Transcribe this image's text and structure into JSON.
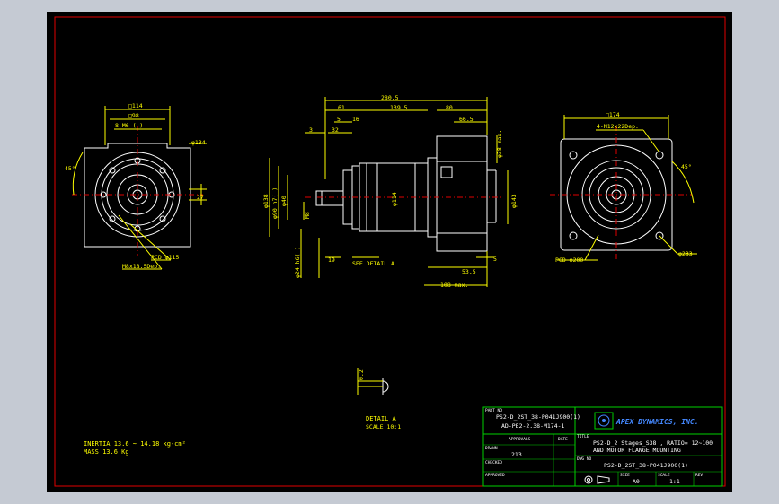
{
  "colors": {
    "background": "#c5cad3",
    "sheet": "#000000",
    "frame": "#e00000",
    "geometry": "#ffffff",
    "dimensions": "#ffff00",
    "title_block": "#00d000",
    "brand": "#4488ff"
  },
  "left_view": {
    "sq_top": "□114",
    "sq_inner": "□98",
    "bolt_pattern": "8 M6 ( )",
    "dia_134": "φ134",
    "angle": "45°",
    "dim_27": "27",
    "pcd": "PCD φ115",
    "thread": "M8x18.5Dep."
  },
  "side_view": {
    "overall": "280.5",
    "d61": "61",
    "d139_5": "139.5",
    "d80": "80",
    "d66_5": "66.5",
    "d5": "5",
    "d16": "16",
    "d3": "3",
    "d32": "32",
    "dia138": "φ138",
    "dia90": "φ90 h7( )",
    "dia40": "φ40",
    "m8": "M8",
    "dia24": "φ24 h6( )",
    "dia114": "φ114",
    "dia143": "φ143",
    "dia38": "φ38 max.",
    "d19": "19",
    "see_detail": "SEE DETAIL A",
    "d53_5": "53.5",
    "d5b": "5",
    "d108": "108 max."
  },
  "right_view": {
    "sq174": "□174",
    "holes": "4-M12x22Dep.",
    "angle": "45°",
    "pcd": "PCD φ200",
    "dia233": "φ233"
  },
  "detail": {
    "dim": "0.2",
    "label": "DETAIL A",
    "scale": "SCALE 10:1"
  },
  "notes": {
    "inertia": "INERTIA 13.6 ~ 14.18 kg-cm²",
    "mass": "MASS 13.6 Kg"
  },
  "title_block": {
    "part_no_label": "PART NO",
    "part_no_1": "PS2-D_2ST_38-P041J900(1)",
    "part_no_2": "AD-PE2-2.38-M174-1",
    "approvals_label": "APPROVALS",
    "date_label": "DATE",
    "drawn_label": "DRAWN",
    "drawn_value": "213",
    "checked_label": "CHECKED",
    "approved_label": "APPROVED",
    "company": "APEX DYNAMICS, INC.",
    "title_label": "TITLE",
    "title_1": "PS2-D_2 Stages_S38 , RATIO= 12~100",
    "title_2": "AND MOTOR FLANGE MOUNTING",
    "dwg_label": "DWG NO",
    "dwg_value": "PS2-D_2ST_38-P041J900(1)",
    "size_label": "SIZE",
    "size_value": "A0",
    "scale_label": "SCALE",
    "scale_value": "1:1",
    "rev_label": "REV"
  }
}
